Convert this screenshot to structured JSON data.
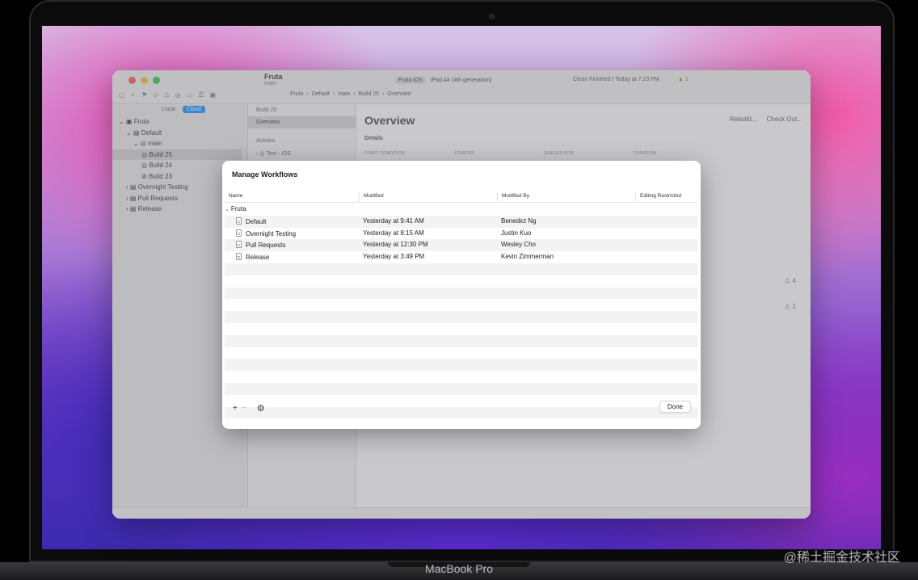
{
  "device": {
    "brand": "MacBook Pro"
  },
  "watermark": "@稀土掘金技术社区",
  "xcode": {
    "project": {
      "name": "Fruta",
      "branch": "main"
    },
    "scheme": {
      "target": "Fruta iOS",
      "device": "iPad Air (4th generation)"
    },
    "status": "Clean Finished | Today at 7:23 PM",
    "warnings": "1",
    "jump_bar": [
      "Fruta",
      "Default",
      "main",
      "Build 25",
      "Overview"
    ],
    "navigator": {
      "segments": [
        "Local",
        "Cloud"
      ],
      "active_segment": "Cloud",
      "tree": [
        {
          "label": "Fruta",
          "indent": 0
        },
        {
          "label": "Default",
          "indent": 1
        },
        {
          "label": "main",
          "indent": 2
        },
        {
          "label": "Build 25",
          "indent": 3,
          "selected": true
        },
        {
          "label": "Build 24",
          "indent": 3
        },
        {
          "label": "Build 23",
          "indent": 3
        },
        {
          "label": "Overnight Testing",
          "indent": 1
        },
        {
          "label": "Pull Requests",
          "indent": 1
        },
        {
          "label": "Release",
          "indent": 1
        }
      ]
    },
    "build_column": {
      "header": "Build 25",
      "selected": "Overview",
      "section": "Actions",
      "action": "Test - iOS"
    },
    "main": {
      "title": "Overview",
      "rebuild": "Rebuild...",
      "checkout": "Check Out...",
      "details": "Details",
      "columns": [
        "START CONDITION",
        "STARTED",
        "QUEUED FOR",
        "DURATION"
      ],
      "warn_counts": [
        "4",
        "1"
      ]
    }
  },
  "sheet": {
    "title": "Manage Workflows",
    "columns": {
      "name": "Name",
      "modified": "Modified",
      "modified_by": "Modified By",
      "editing_restricted": "Editing Restricted"
    },
    "group": "Fruta",
    "rows": [
      {
        "name": "Default",
        "modified": "Yesterday at 9:41 AM",
        "modified_by": "Benedict Ng"
      },
      {
        "name": "Overnight Testing",
        "modified": "Yesterday at 8:15 AM",
        "modified_by": "Justin Kuo"
      },
      {
        "name": "Pull Requests",
        "modified": "Yesterday at 12:30 PM",
        "modified_by": "Wesley Cho"
      },
      {
        "name": "Release",
        "modified": "Yesterday at 3:49 PM",
        "modified_by": "Kevin Zimmerman"
      }
    ],
    "footer": {
      "add": "+",
      "remove": "−",
      "gear_icon": "gear-icon",
      "done": "Done"
    }
  }
}
